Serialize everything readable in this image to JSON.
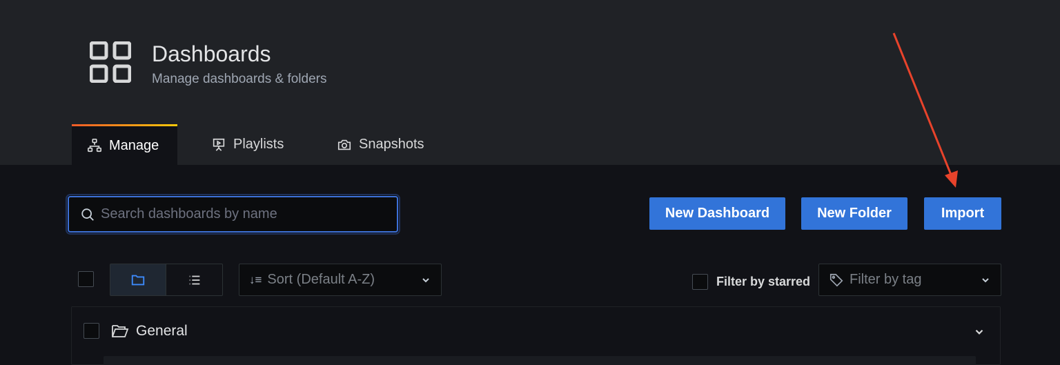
{
  "header": {
    "title": "Dashboards",
    "subtitle": "Manage dashboards & folders",
    "icon": "dashboards-grid-icon"
  },
  "tabs": [
    {
      "label": "Manage",
      "icon": "sitemap-icon",
      "active": true
    },
    {
      "label": "Playlists",
      "icon": "presentation-icon",
      "active": false
    },
    {
      "label": "Snapshots",
      "icon": "camera-icon",
      "active": false
    }
  ],
  "search": {
    "placeholder": "Search dashboards by name",
    "value": ""
  },
  "actions": {
    "new_dashboard": "New Dashboard",
    "new_folder": "New Folder",
    "import": "Import"
  },
  "toolbar": {
    "view_mode": "folders",
    "sort_label": "Sort (Default A-Z)",
    "filter_starred_label": "Filter by starred",
    "filter_tag_placeholder": "Filter by tag"
  },
  "folders": [
    {
      "name": "General",
      "expanded": true
    }
  ],
  "colors": {
    "primary_button": "#3274d9",
    "focus_border": "#3d71d9",
    "tab_gradient_start": "#f05a28",
    "tab_gradient_end": "#fbca0a",
    "annotation_arrow": "#e8432b"
  }
}
